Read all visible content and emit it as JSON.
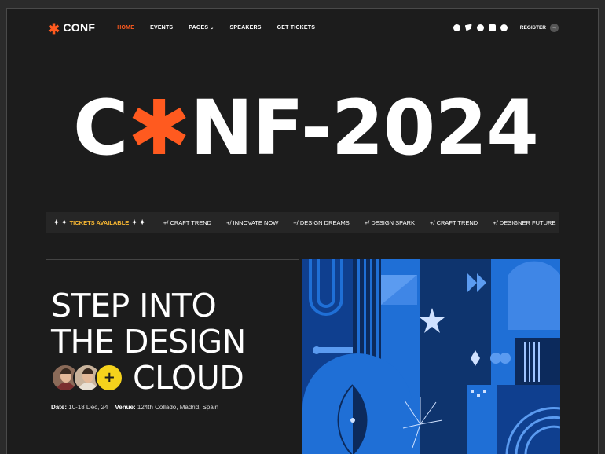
{
  "nav": {
    "logo_text": "CONF",
    "logo_symbol": "✱",
    "items": [
      {
        "label": "HOME",
        "active": true
      },
      {
        "label": "EVENTS",
        "active": false
      },
      {
        "label": "PAGES",
        "active": false,
        "dropdown": true
      },
      {
        "label": "SPEAKERS",
        "active": false
      },
      {
        "label": "GET TICKETS",
        "active": false
      }
    ],
    "socials": [
      "facebook-icon",
      "twitter-icon",
      "github-icon",
      "linkedin-icon",
      "dribbble-icon"
    ],
    "register_label": "REGISTER",
    "register_arrow": "→"
  },
  "hero": {
    "title_pre": "C",
    "title_star": "✱",
    "title_post": "NF-2024"
  },
  "ticker": {
    "sparkle": "✦ ✦",
    "tickets_label": "TICKETS AVAILABLE",
    "items": [
      "+/ CRAFT TREND",
      "+/ INNOVATE NOW",
      "+/ DESIGN DREAMS",
      "+/ DESIGN SPARK",
      "+/ CRAFT TREND",
      "+/ DESIGNER FUTURE"
    ]
  },
  "headline": {
    "line1": "STEP INTO",
    "line2": "THE DESIGN",
    "line3": "CLOUD",
    "plus_label": "+"
  },
  "info": {
    "date_label": "Date:",
    "date_value": "10-18 Dec, 24",
    "venue_label": "Venue:",
    "venue_value": "124th Collado, Madrid, Spain"
  },
  "colors": {
    "accent": "#ff5a1f",
    "tickets": "#f7b733",
    "plus": "#f5d21c",
    "art_blue": "#1f6fd6",
    "art_navy": "#0c2a5c"
  }
}
